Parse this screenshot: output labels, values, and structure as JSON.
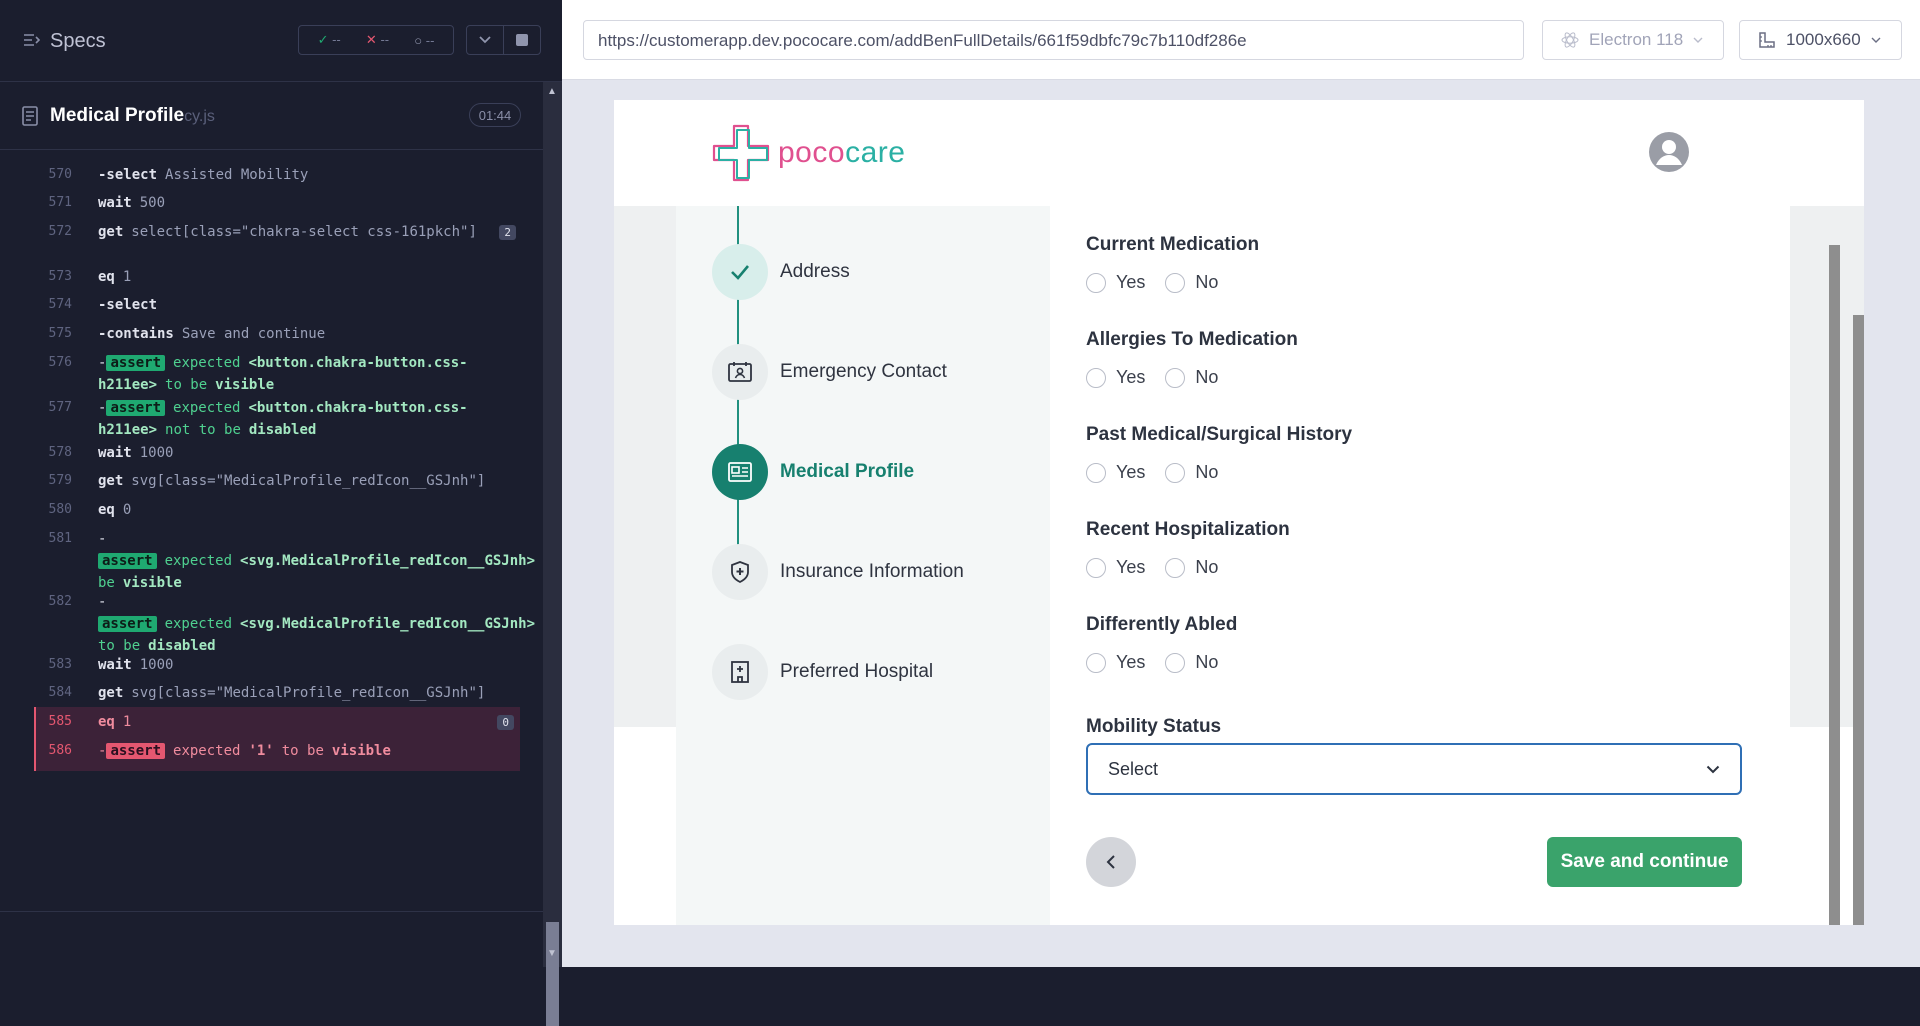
{
  "runner": {
    "specs_label": "Specs",
    "stats": {
      "passed": "--",
      "failed": "--",
      "pending": "--"
    },
    "spec": {
      "name": "Medical Profile",
      "ext": "cy.js",
      "time": "01:44"
    },
    "commands": [
      {
        "num": "570",
        "name": "-select",
        "arg": "Assisted Mobility"
      },
      {
        "num": "571",
        "name": "wait",
        "arg": "500"
      },
      {
        "num": "572",
        "name": "get",
        "arg": "select[class=\"chakra-select css-161pkch\"]",
        "badge": "2"
      },
      {
        "num": "573",
        "name": "eq",
        "arg": "1"
      },
      {
        "num": "574",
        "name": "-select",
        "arg": ""
      },
      {
        "num": "575",
        "name": "-contains",
        "arg": "Save and continue"
      },
      {
        "num": "576",
        "assert": "assert",
        "pre": "expected",
        "subject": "<button.chakra-button.css-h211ee>",
        "mid": "to be",
        "post": "visible"
      },
      {
        "num": "577",
        "assert": "assert",
        "pre": "expected",
        "subject": "<button.chakra-button.css-h211ee>",
        "mid": "not to be",
        "post": "disabled"
      },
      {
        "num": "578",
        "name": "wait",
        "arg": "1000"
      },
      {
        "num": "579",
        "name": "get",
        "arg": "svg[class=\"MedicalProfile_redIcon__GSJnh\"]"
      },
      {
        "num": "580",
        "name": "eq",
        "arg": "0"
      },
      {
        "num": "581",
        "assert": "assert",
        "pre": "expected",
        "subject": "<svg.MedicalProfile_redIcon__GSJnh>",
        "mid": "to be",
        "post": "visible"
      },
      {
        "num": "582",
        "assert": "assert",
        "pre": "expected",
        "subject": "<svg.MedicalProfile_redIcon__GSJnh>",
        "mid": "not to be",
        "post": "disabled"
      },
      {
        "num": "583",
        "name": "wait",
        "arg": "1000"
      },
      {
        "num": "584",
        "name": "get",
        "arg": "svg[class=\"MedicalProfile_redIcon__GSJnh\"]"
      },
      {
        "num": "585",
        "name": "eq",
        "arg": "1",
        "badge": "0",
        "fail": true
      },
      {
        "num": "586",
        "assert": "assert",
        "pre": "expected",
        "subject": "'1'",
        "mid": "to be",
        "post": "visible",
        "fail": true
      }
    ]
  },
  "browser": {
    "url": "https://customerapp.dev.pococare.com/addBenFullDetails/661f59dbfc79c7b110df286e",
    "browser_name": "Electron 118",
    "viewport": "1000x660"
  },
  "app": {
    "logo": {
      "part1": "poco",
      "part2": "care"
    },
    "steps": [
      {
        "label": "Address",
        "state": "done",
        "icon": "check-icon"
      },
      {
        "label": "Emergency Contact",
        "state": "todo",
        "icon": "contact-card-icon"
      },
      {
        "label": "Medical Profile",
        "state": "active",
        "icon": "id-card-icon"
      },
      {
        "label": "Insurance Information",
        "state": "todo",
        "icon": "shield-plus-icon"
      },
      {
        "label": "Preferred Hospital",
        "state": "todo",
        "icon": "hospital-icon"
      }
    ],
    "questions": [
      {
        "label": "Current Medication",
        "yes": "Yes",
        "no": "No"
      },
      {
        "label": "Allergies To Medication",
        "yes": "Yes",
        "no": "No"
      },
      {
        "label": "Past Medical/Surgical History",
        "yes": "Yes",
        "no": "No"
      },
      {
        "label": "Recent Hospitalization",
        "yes": "Yes",
        "no": "No"
      },
      {
        "label": "Differently Abled",
        "yes": "Yes",
        "no": "No"
      }
    ],
    "mobility": {
      "label": "Mobility Status",
      "value": "Select"
    },
    "save_label": "Save and continue"
  }
}
